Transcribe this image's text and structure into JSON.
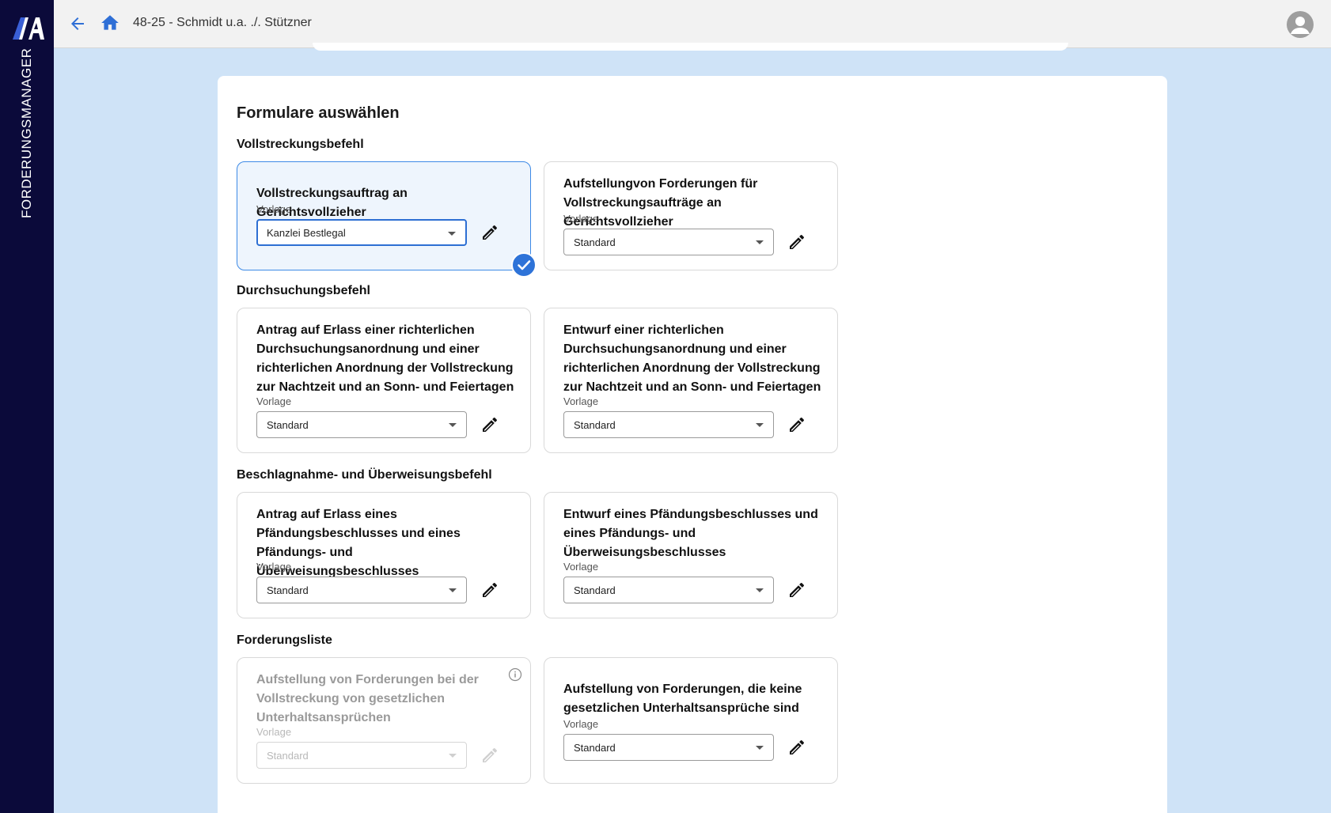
{
  "app": {
    "name": "FORDERUNGSMANAGER",
    "logo": "AA"
  },
  "header": {
    "breadcrumb": "48-25 - Schmidt u.a. ./. Stützner"
  },
  "panel": {
    "title": "Formulare auswählen",
    "sections": [
      {
        "title": "Vollstreckungsbefehl",
        "cards": [
          {
            "title": "Vollstreckungsauftrag an Gerichtsvollzieher",
            "label": "Vorlage",
            "value": "Kanzlei Bestlegal"
          },
          {
            "title": "Aufstellungvon Forderungen für Vollstreckungsaufträge an Gerichtsvollzieher",
            "label": "Vorlage",
            "value": "Standard"
          }
        ]
      },
      {
        "title": "Durchsuchungsbefehl",
        "cards": [
          {
            "title": "Antrag auf Erlass einer richterlichen Durchsuchungsanordnung und einer richterlichen Anordnung der Vollstreckung zur Nachtzeit und an Sonn- und Feiertagen",
            "label": "Vorlage",
            "value": "Standard"
          },
          {
            "title": "Entwurf einer richterlichen Durchsuchungsanordnung und einer richterlichen Anordnung der Vollstreckung zur Nachtzeit und an Sonn- und Feiertagen",
            "label": "Vorlage",
            "value": "Standard"
          }
        ]
      },
      {
        "title": "Beschlagnahme- und Überweisungsbefehl",
        "cards": [
          {
            "title": "Antrag auf Erlass eines Pfändungsbeschlusses und eines Pfändungs- und Überweisungsbeschlusses",
            "label": "Vorlage",
            "value": "Standard"
          },
          {
            "title": "Entwurf eines Pfändungsbeschlusses und eines Pfändungs- und Überweisungsbeschlusses",
            "label": "Vorlage",
            "value": "Standard"
          }
        ]
      },
      {
        "title": "Forderungsliste",
        "cards": [
          {
            "title": "Aufstellung von Forderungen bei der Vollstreckung von gesetzlichen Unterhaltsansprüchen",
            "label": "Vorlage",
            "value": "Standard"
          },
          {
            "title": "Aufstellung von Forderungen, die keine gesetzlichen Unterhaltsansprüche sind",
            "label": "Vorlage",
            "value": "Standard"
          }
        ]
      }
    ]
  },
  "colors": {
    "sidebar": "#0b0a3a",
    "accent": "#2e73d8",
    "background": "#cfe3f7"
  }
}
